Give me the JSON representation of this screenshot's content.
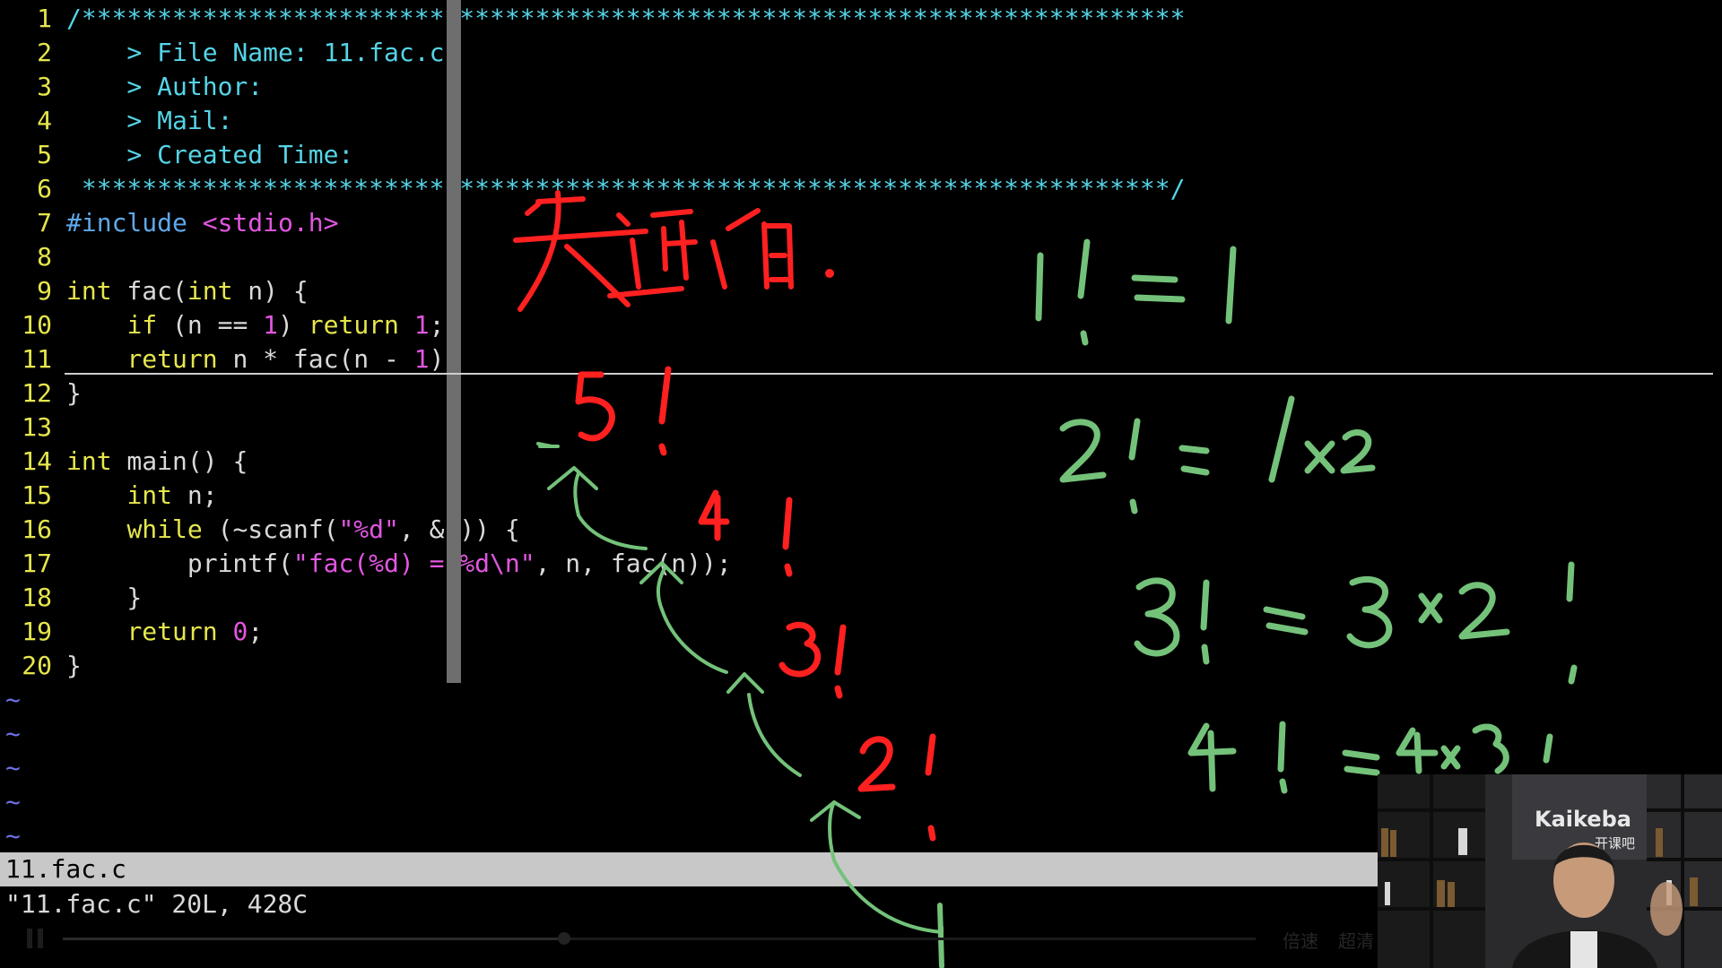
{
  "editor": {
    "lines": [
      {
        "n": "1",
        "tokens": [
          {
            "c": "t-cmt",
            "t": "/*************************************************************************"
          }
        ]
      },
      {
        "n": "2",
        "tokens": [
          {
            "c": "t-cmt",
            "t": "    > File Name: 11.fac.c"
          }
        ]
      },
      {
        "n": "3",
        "tokens": [
          {
            "c": "t-cmt",
            "t": "    > Author:"
          }
        ]
      },
      {
        "n": "4",
        "tokens": [
          {
            "c": "t-cmt",
            "t": "    > Mail:"
          }
        ]
      },
      {
        "n": "5",
        "tokens": [
          {
            "c": "t-cmt",
            "t": "    > Created Time:"
          }
        ]
      },
      {
        "n": "6",
        "tokens": [
          {
            "c": "t-cmt",
            "t": " ************************************************************************/"
          }
        ]
      },
      {
        "n": "7",
        "tokens": [
          {
            "c": "t-pre",
            "t": "#include "
          },
          {
            "c": "t-str",
            "t": "<stdio.h>"
          }
        ]
      },
      {
        "n": "8",
        "tokens": []
      },
      {
        "n": "9",
        "tokens": [
          {
            "c": "t-kw",
            "t": "int"
          },
          {
            "c": "t-plain",
            "t": " fac("
          },
          {
            "c": "t-kw",
            "t": "int"
          },
          {
            "c": "t-plain",
            "t": " n) {"
          }
        ]
      },
      {
        "n": "10",
        "tokens": [
          {
            "c": "t-plain",
            "t": "    "
          },
          {
            "c": "t-kw",
            "t": "if"
          },
          {
            "c": "t-plain",
            "t": " (n == "
          },
          {
            "c": "t-num",
            "t": "1"
          },
          {
            "c": "t-plain",
            "t": ") "
          },
          {
            "c": "t-kw",
            "t": "return"
          },
          {
            "c": "t-plain",
            "t": " "
          },
          {
            "c": "t-num",
            "t": "1"
          },
          {
            "c": "t-plain",
            "t": ";"
          }
        ]
      },
      {
        "n": "11",
        "tokens": [
          {
            "c": "t-plain",
            "t": "    "
          },
          {
            "c": "t-kw",
            "t": "return"
          },
          {
            "c": "t-plain",
            "t": " n * fac(n - "
          },
          {
            "c": "t-num",
            "t": "1"
          },
          {
            "c": "t-plain",
            "t": ");"
          }
        ]
      },
      {
        "n": "12",
        "tokens": [
          {
            "c": "t-plain",
            "t": "}"
          }
        ]
      },
      {
        "n": "13",
        "tokens": []
      },
      {
        "n": "14",
        "tokens": [
          {
            "c": "t-kw",
            "t": "int"
          },
          {
            "c": "t-plain",
            "t": " main() {"
          }
        ]
      },
      {
        "n": "15",
        "tokens": [
          {
            "c": "t-plain",
            "t": "    "
          },
          {
            "c": "t-kw",
            "t": "int"
          },
          {
            "c": "t-plain",
            "t": " n;"
          }
        ]
      },
      {
        "n": "16",
        "tokens": [
          {
            "c": "t-plain",
            "t": "    "
          },
          {
            "c": "t-kw",
            "t": "while"
          },
          {
            "c": "t-plain",
            "t": " (~scanf("
          },
          {
            "c": "t-str",
            "t": "\"%d\""
          },
          {
            "c": "t-plain",
            "t": ", &n)) {"
          }
        ]
      },
      {
        "n": "17",
        "tokens": [
          {
            "c": "t-plain",
            "t": "        printf("
          },
          {
            "c": "t-str",
            "t": "\"fac(%d) = %d\\n\""
          },
          {
            "c": "t-plain",
            "t": ", n, fac(n));"
          }
        ]
      },
      {
        "n": "18",
        "tokens": [
          {
            "c": "t-plain",
            "t": "    }"
          }
        ]
      },
      {
        "n": "19",
        "tokens": [
          {
            "c": "t-plain",
            "t": "    "
          },
          {
            "c": "t-kw",
            "t": "return"
          },
          {
            "c": "t-plain",
            "t": " "
          },
          {
            "c": "t-num",
            "t": "0"
          },
          {
            "c": "t-plain",
            "t": ";"
          }
        ]
      },
      {
        "n": "20",
        "tokens": [
          {
            "c": "t-plain",
            "t": "}"
          }
        ]
      }
    ],
    "tilde_count": 5,
    "tilde_char": "~",
    "statusline": "11.fac.c",
    "cmdline": "\"11.fac.c\" 20L, 428C"
  },
  "annotations": {
    "red_heading": "先递归",
    "red_chain": [
      "5!",
      "4!",
      "3!",
      "2!"
    ],
    "green_chain_bottom": "1",
    "green_equations": [
      "1! = 1",
      "2! = 1×2",
      "3! = 3×2!",
      "4! = 4×3!"
    ]
  },
  "player": {
    "speed_label": "倍速",
    "quality_label": "超清",
    "progress": 0.42
  },
  "webcam": {
    "brand": "kaikeba",
    "brand_cn": "开课吧"
  },
  "colors": {
    "comment": "#55d4e6",
    "keyword": "#e6e64d",
    "string": "#e256e0",
    "line_number": "#e6e64d",
    "tilde": "#6f72e8",
    "ink_red": "#ff2020",
    "ink_green": "#74c27a"
  }
}
